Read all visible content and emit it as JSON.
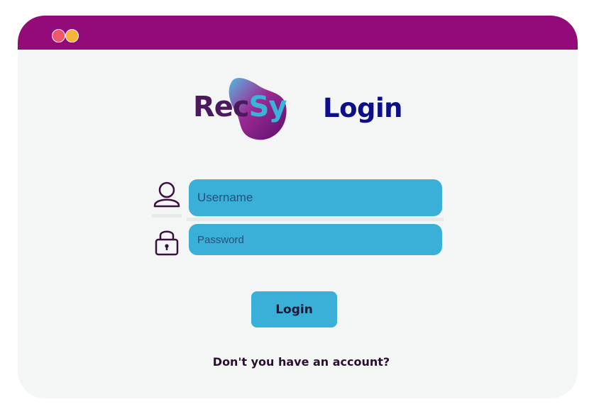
{
  "window": {
    "controls": [
      "close",
      "minimize"
    ]
  },
  "logo": {
    "text_part1": "Rec",
    "text_part2": "Sy",
    "icon": "blob-logo-icon"
  },
  "header": {
    "title": "Login"
  },
  "form": {
    "username_placeholder": "Username",
    "username_value": "",
    "username_icon": "user-icon",
    "password_placeholder": "Password",
    "password_value": "",
    "password_icon": "lock-icon",
    "login_label": "Login",
    "signup_prompt": "Don't you have an account?"
  },
  "colors": {
    "titlebar": "#930b78",
    "background": "#f4f6f6",
    "input": "#3aafd7",
    "heading": "#0d0f86",
    "close_dot": "#f3566a",
    "minimize_dot": "#f7b33a"
  }
}
